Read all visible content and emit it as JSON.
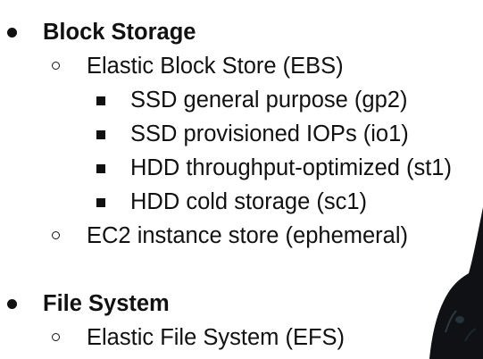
{
  "sections": [
    {
      "label": "Block Storage",
      "items": [
        {
          "label": "Elastic Block Store (EBS)",
          "subitems": [
            "SSD general purpose (gp2)",
            "SSD provisioned IOPs (io1)",
            "HDD throughput-optimized (st1)",
            "HDD cold storage (sc1)"
          ]
        },
        {
          "label": "EC2 instance store (ephemeral)"
        }
      ]
    },
    {
      "label": "File System",
      "items": [
        {
          "label": "Elastic File System (EFS)"
        }
      ]
    }
  ],
  "colors": {
    "text": "#111111",
    "background": "#ffffff"
  },
  "icons": {
    "level1": "filled-circle-bullet",
    "level2": "hollow-circle-bullet",
    "level3": "filled-square-bullet"
  }
}
